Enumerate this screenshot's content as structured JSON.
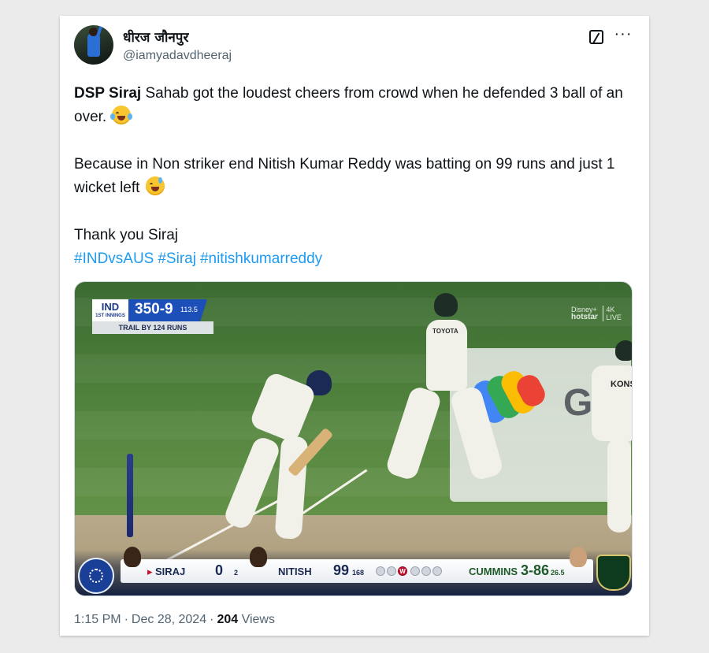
{
  "author": {
    "display_name": "धीरज जौनपुर",
    "handle": "@iamyadavdheeraj"
  },
  "tweet": {
    "para1_bold": "DSP Siraj",
    "para1_rest": " Sahab got the loudest cheers from crowd when he defended 3 ball of an over.",
    "para1_emoji": "face-with-tears-of-joy",
    "para2": "Because in Non striker end Nitish Kumar Reddy was batting on 99 runs and just 1 wicket left",
    "para2_emoji": "grinning-face-with-sweat",
    "para3": "Thank you Siraj",
    "hashtags": [
      "#INDvsAUS",
      "#Siraj",
      "#nitishkumarreddy"
    ]
  },
  "media": {
    "scoreboard": {
      "team": "IND",
      "innings": "1ST INNINGS",
      "score": "350-9",
      "overs": "113.5",
      "trail_text": "TRAIL BY 124 RUNS"
    },
    "broadcaster": {
      "brand_line1": "Disney+",
      "brand_line2": "hotstar",
      "tag_line1": "4K",
      "tag_line2": "LIVE"
    },
    "bottom_strip": {
      "batter1_name": "SIRAJ",
      "batter1_runs": "0",
      "batter1_balls": "2",
      "batter2_name": "NITISH",
      "batter2_runs": "99",
      "batter2_balls": "168",
      "over_balls": [
        "dot",
        "dot",
        "W",
        "dot",
        "dot",
        "dot"
      ],
      "bowler_name": "CUMMINS",
      "bowler_figures": "3-86",
      "bowler_overs": "26.5"
    },
    "jersey_text": "KONS",
    "shirt_sponsor": "TOYOTA",
    "board_letter": "G",
    "colors": {
      "gpay_blue": "#4285f4",
      "gpay_red": "#ea4335",
      "gpay_yellow": "#fbbc04",
      "gpay_green": "#34a853",
      "ind_blue": "#1d4fb8"
    }
  },
  "meta": {
    "time": "1:15 PM",
    "date": "Dec 28, 2024",
    "views_count": "204",
    "views_label": "Views"
  }
}
